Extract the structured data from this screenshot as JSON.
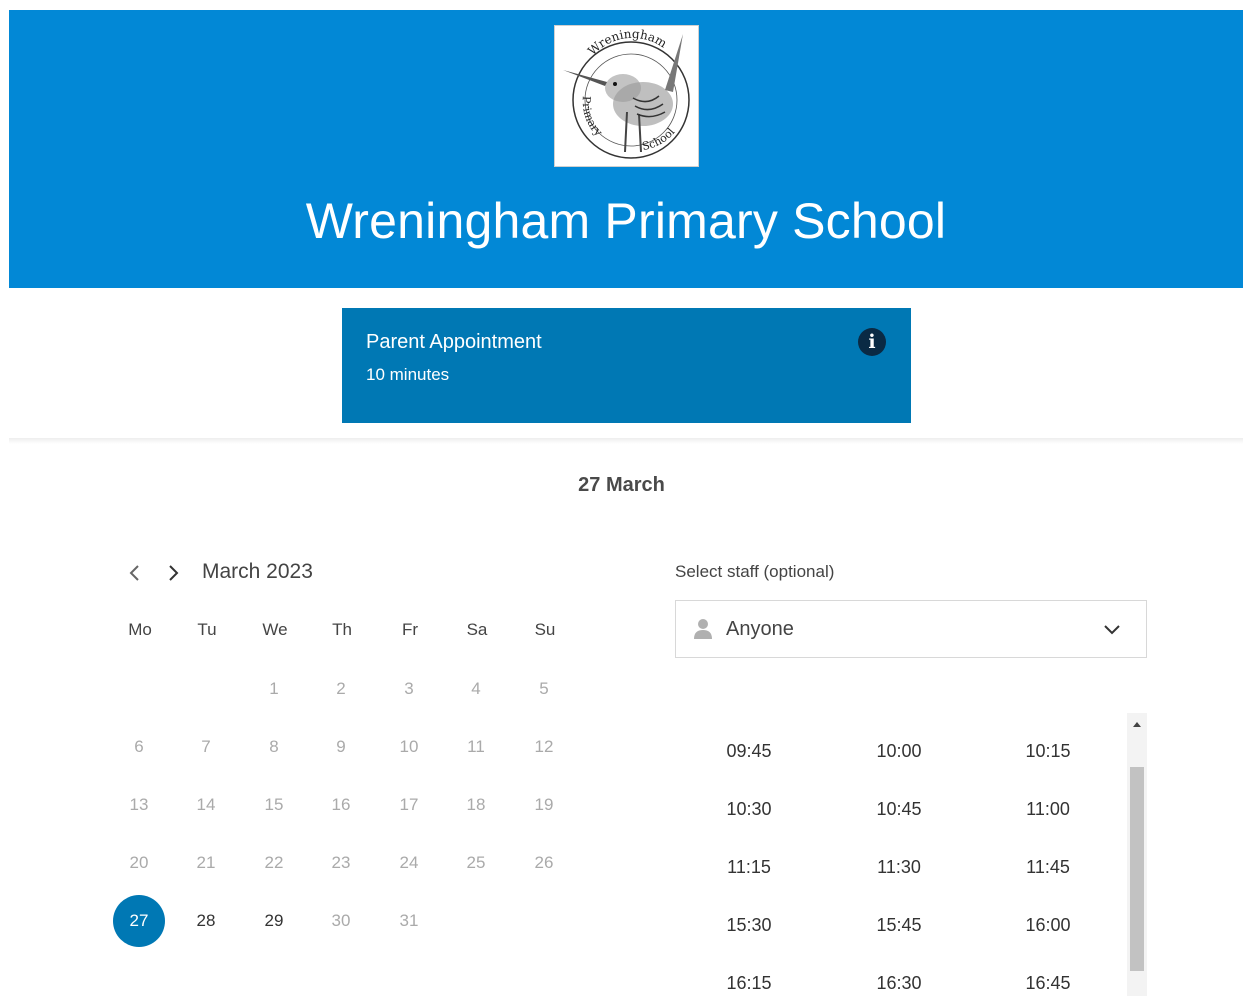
{
  "school": {
    "name": "Wreningham Primary School",
    "logo_text_top": "Wreningham",
    "logo_text_left": "Primary",
    "logo_text_right": "School"
  },
  "service": {
    "name": "Parent Appointment",
    "duration": "10 minutes",
    "info_icon": "info-icon"
  },
  "selected_date": "27 March",
  "calendar": {
    "month": "March 2023",
    "prev_icon": "chevron-left-icon",
    "next_icon": "chevron-right-icon",
    "weekdays": [
      "Mo",
      "Tu",
      "We",
      "Th",
      "Fr",
      "Sa",
      "Su"
    ],
    "days": [
      "1",
      "2",
      "3",
      "4",
      "5",
      "6",
      "7",
      "8",
      "9",
      "10",
      "11",
      "12",
      "13",
      "14",
      "15",
      "16",
      "17",
      "18",
      "19",
      "20",
      "21",
      "22",
      "23",
      "24",
      "25",
      "26",
      "27",
      "28",
      "29",
      "30",
      "31"
    ],
    "selected_day": "27",
    "available_days": [
      "27",
      "28",
      "29"
    ]
  },
  "staff": {
    "label": "Select staff (optional)",
    "value": "Anyone",
    "icon": "person-icon",
    "dropdown_icon": "chevron-down-icon"
  },
  "times": [
    "09:45",
    "10:00",
    "10:15",
    "10:30",
    "10:45",
    "11:00",
    "11:15",
    "11:30",
    "11:45",
    "15:30",
    "15:45",
    "16:00",
    "16:15",
    "16:30",
    "16:45"
  ],
  "colors": {
    "banner": "#0288d6",
    "accent": "#0078b4"
  }
}
